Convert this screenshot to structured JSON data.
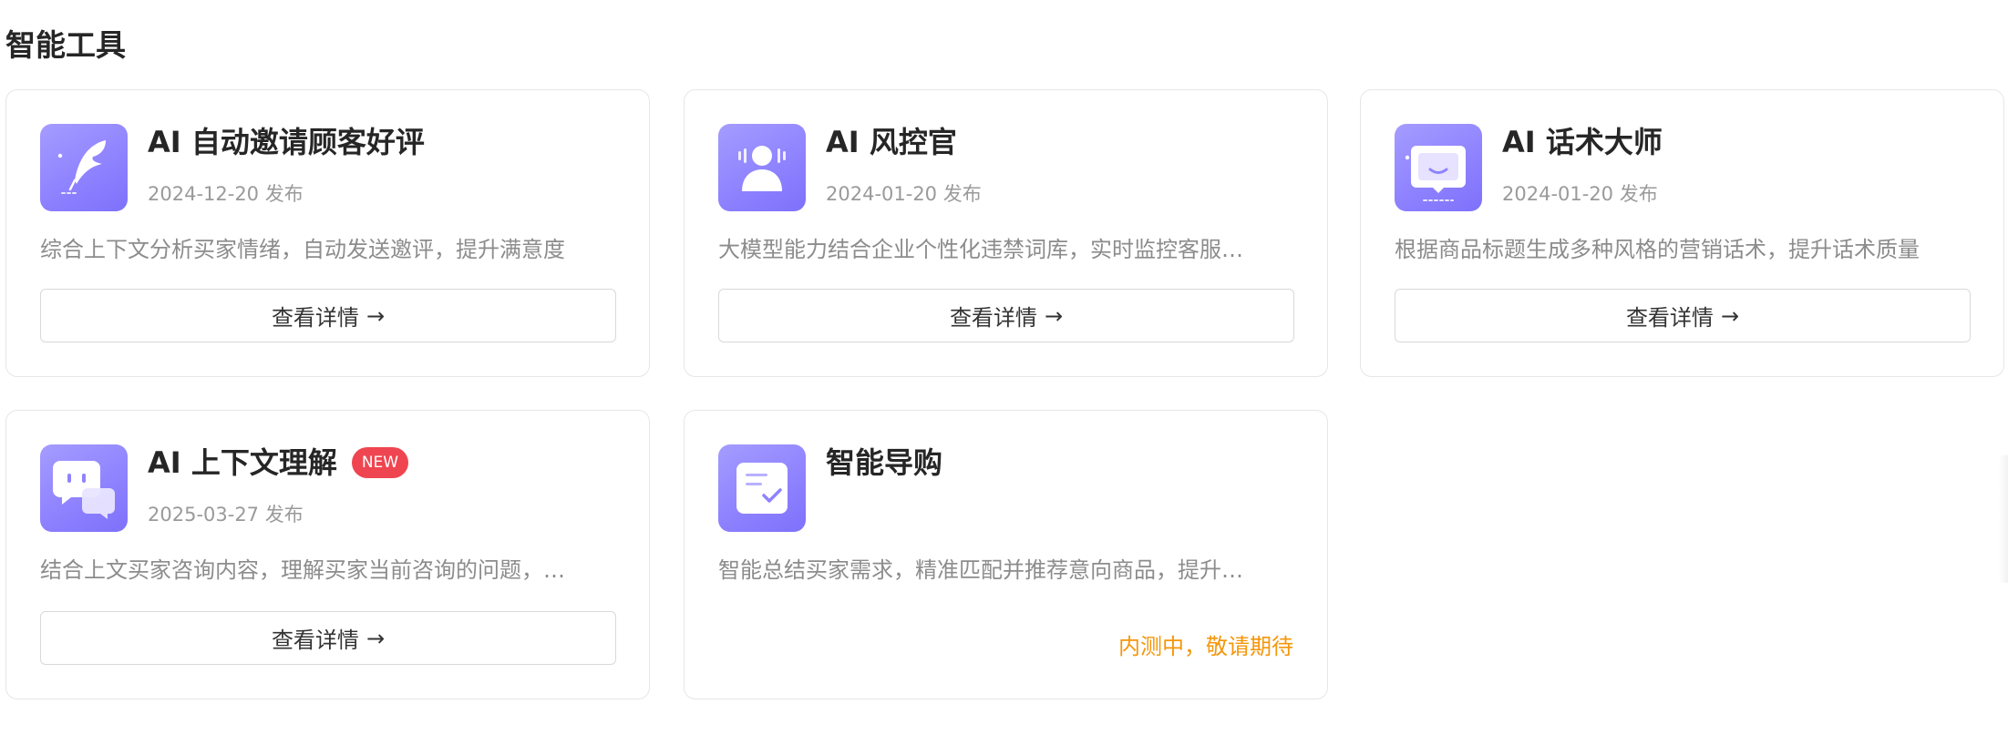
{
  "section": {
    "title": "智能工具"
  },
  "tools": [
    {
      "icon": "feather-icon",
      "title": "AI 自动邀请顾客好评",
      "date": "2024-12-20 发布",
      "description": "综合上下文分析买家情绪，自动发送邀评，提升满意度",
      "button_label": "查看详情",
      "button_arrow": "→"
    },
    {
      "icon": "risk-officer-icon",
      "title": "AI 风控官",
      "date": "2024-01-20 发布",
      "description": "大模型能力结合企业个性化违禁词库，实时监控客服…",
      "button_label": "查看详情",
      "button_arrow": "→"
    },
    {
      "icon": "speech-bubble-icon",
      "title": "AI 话术大师",
      "date": "2024-01-20 发布",
      "description": "根据商品标题生成多种风格的营销话术，提升话术质量",
      "button_label": "查看详情",
      "button_arrow": "→"
    },
    {
      "icon": "chat-bubbles-icon",
      "title": "AI 上下文理解",
      "badge": "NEW",
      "date": "2025-03-27 发布",
      "description": "结合上文买家咨询内容，理解买家当前咨询的问题，…",
      "button_label": "查看详情",
      "button_arrow": "→"
    },
    {
      "icon": "checklist-icon",
      "title": "智能导购",
      "description": "智能总结买家需求，精准匹配并推荐意向商品，提升…",
      "status": "内测中，敬请期待"
    }
  ],
  "colors": {
    "icon_gradient_start": "#a59cff",
    "icon_gradient_end": "#7e71fb",
    "badge_new": "#ef4550",
    "status_orange": "#f5960a",
    "text_secondary": "#8c8c8c"
  }
}
